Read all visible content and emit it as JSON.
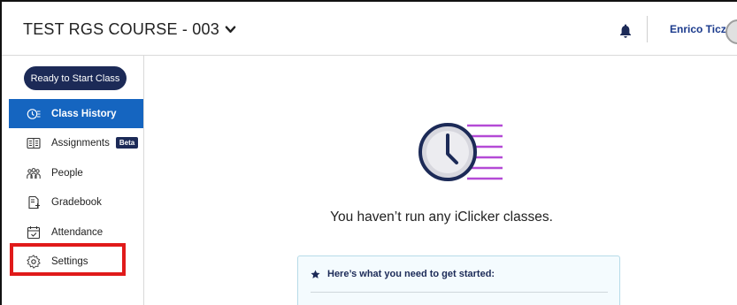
{
  "header": {
    "course_title": "TEST RGS COURSE - 003",
    "user_name": "Enrico Ticz"
  },
  "sidebar": {
    "start_button_label": "Ready to Start Class",
    "items": [
      {
        "label": "Class History",
        "icon": "class-history-icon",
        "active": true
      },
      {
        "label": "Assignments",
        "icon": "assignments-icon",
        "badge": "Beta"
      },
      {
        "label": "People",
        "icon": "people-icon"
      },
      {
        "label": "Gradebook",
        "icon": "gradebook-icon"
      },
      {
        "label": "Attendance",
        "icon": "attendance-icon"
      },
      {
        "label": "Settings",
        "icon": "settings-icon"
      }
    ]
  },
  "main": {
    "empty_message": "You haven’t run any iClicker classes.",
    "card_title": "Here’s what you need to get started:"
  },
  "colors": {
    "primary_nav": "#1c2a57",
    "active_item": "#1565c0",
    "highlight_box": "#e01a1a",
    "clock_accent": "#b44ad6"
  }
}
